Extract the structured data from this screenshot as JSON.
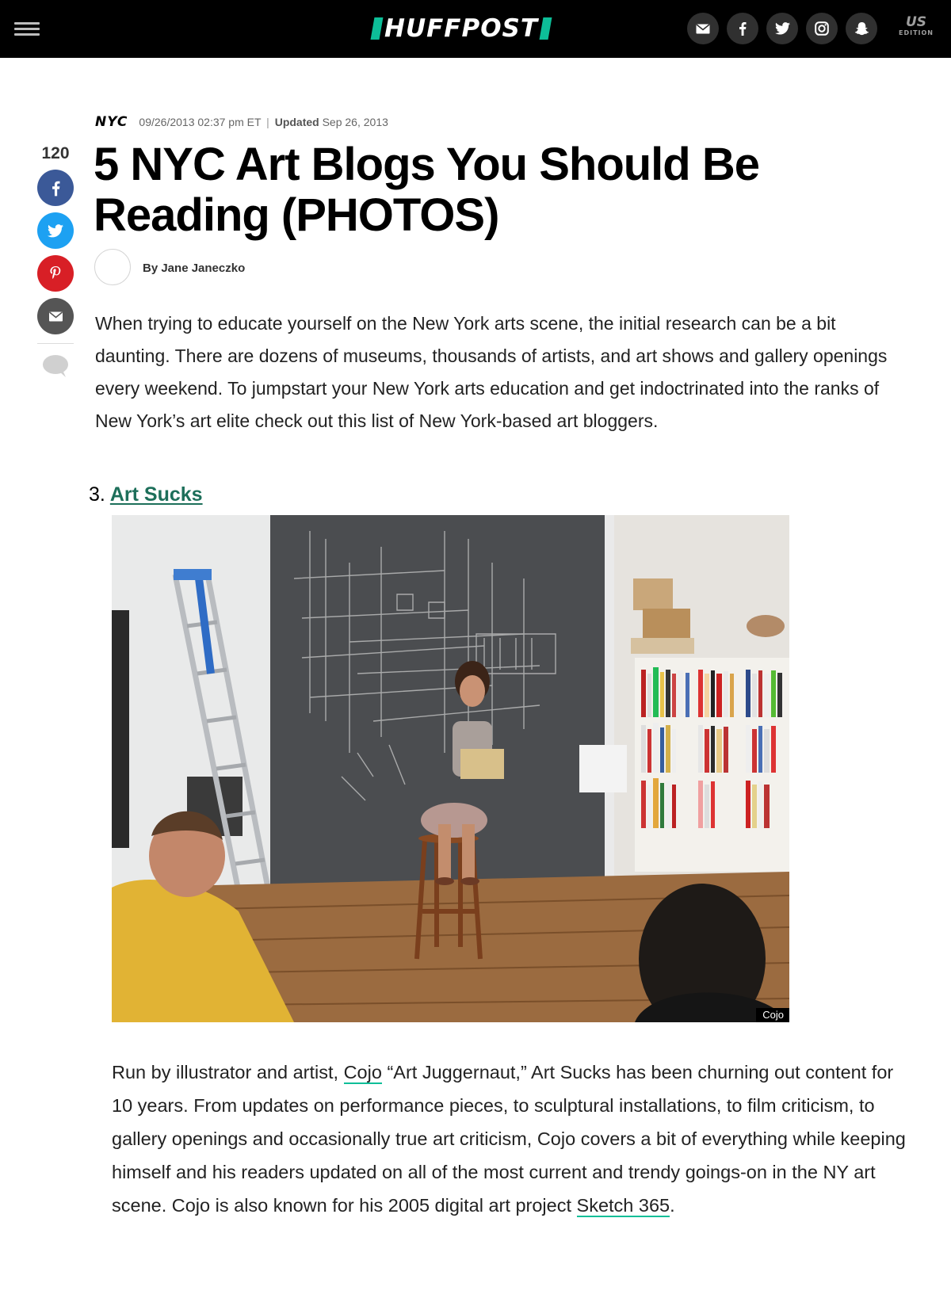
{
  "header": {
    "logo_text": "HUFFPOST",
    "edition_top": "US",
    "edition_bottom": "EDITION",
    "social_icons": [
      "email-icon",
      "facebook-icon",
      "twitter-icon",
      "instagram-icon",
      "snapchat-icon"
    ],
    "background_color": "#000000",
    "accent_color": "#0dbe98"
  },
  "share": {
    "count": "120",
    "buttons": [
      {
        "name": "facebook",
        "color": "#3b5998"
      },
      {
        "name": "twitter",
        "color": "#1da1f2"
      },
      {
        "name": "pinterest",
        "color": "#d81f26"
      },
      {
        "name": "email",
        "color": "#555555"
      }
    ]
  },
  "article": {
    "section": "NYC",
    "published": "09/26/2013 02:37 pm ET",
    "separator": "|",
    "updated_label": "Updated",
    "updated_date": "Sep 26, 2013",
    "headline": "5 NYC Art Blogs You Should Be Reading (PHOTOS)",
    "byline": "By Jane Janeczko",
    "intro": "When trying to educate yourself on the New York arts scene, the initial research can be a bit daunting. There are dozens of museums, thousands of artists, and art shows and gallery openings every weekend. To jumpstart your New York arts education and get indoctrinated into the ranks of New York’s art elite check out this list of New York-based art bloggers."
  },
  "list_item": {
    "number": "3.",
    "title": "Art Sucks",
    "link_color": "#1d6f5a"
  },
  "photo": {
    "credit": "Cojo"
  },
  "description": {
    "part1": "Run by illustrator and artist, ",
    "link1": "Cojo",
    "part2": " “Art Juggernaut,” Art Sucks has been churning out content for 10 years. From updates on performance pieces, to sculptural installations, to film criticism, to gallery openings and occasionally true art criticism, Cojo covers a bit of everything while keeping himself and his readers updated on all of the most current and trendy goings-on in the NY art scene. Cojo is also known for his 2005 digital art project ",
    "link2": "Sketch 365",
    "part3": "."
  }
}
